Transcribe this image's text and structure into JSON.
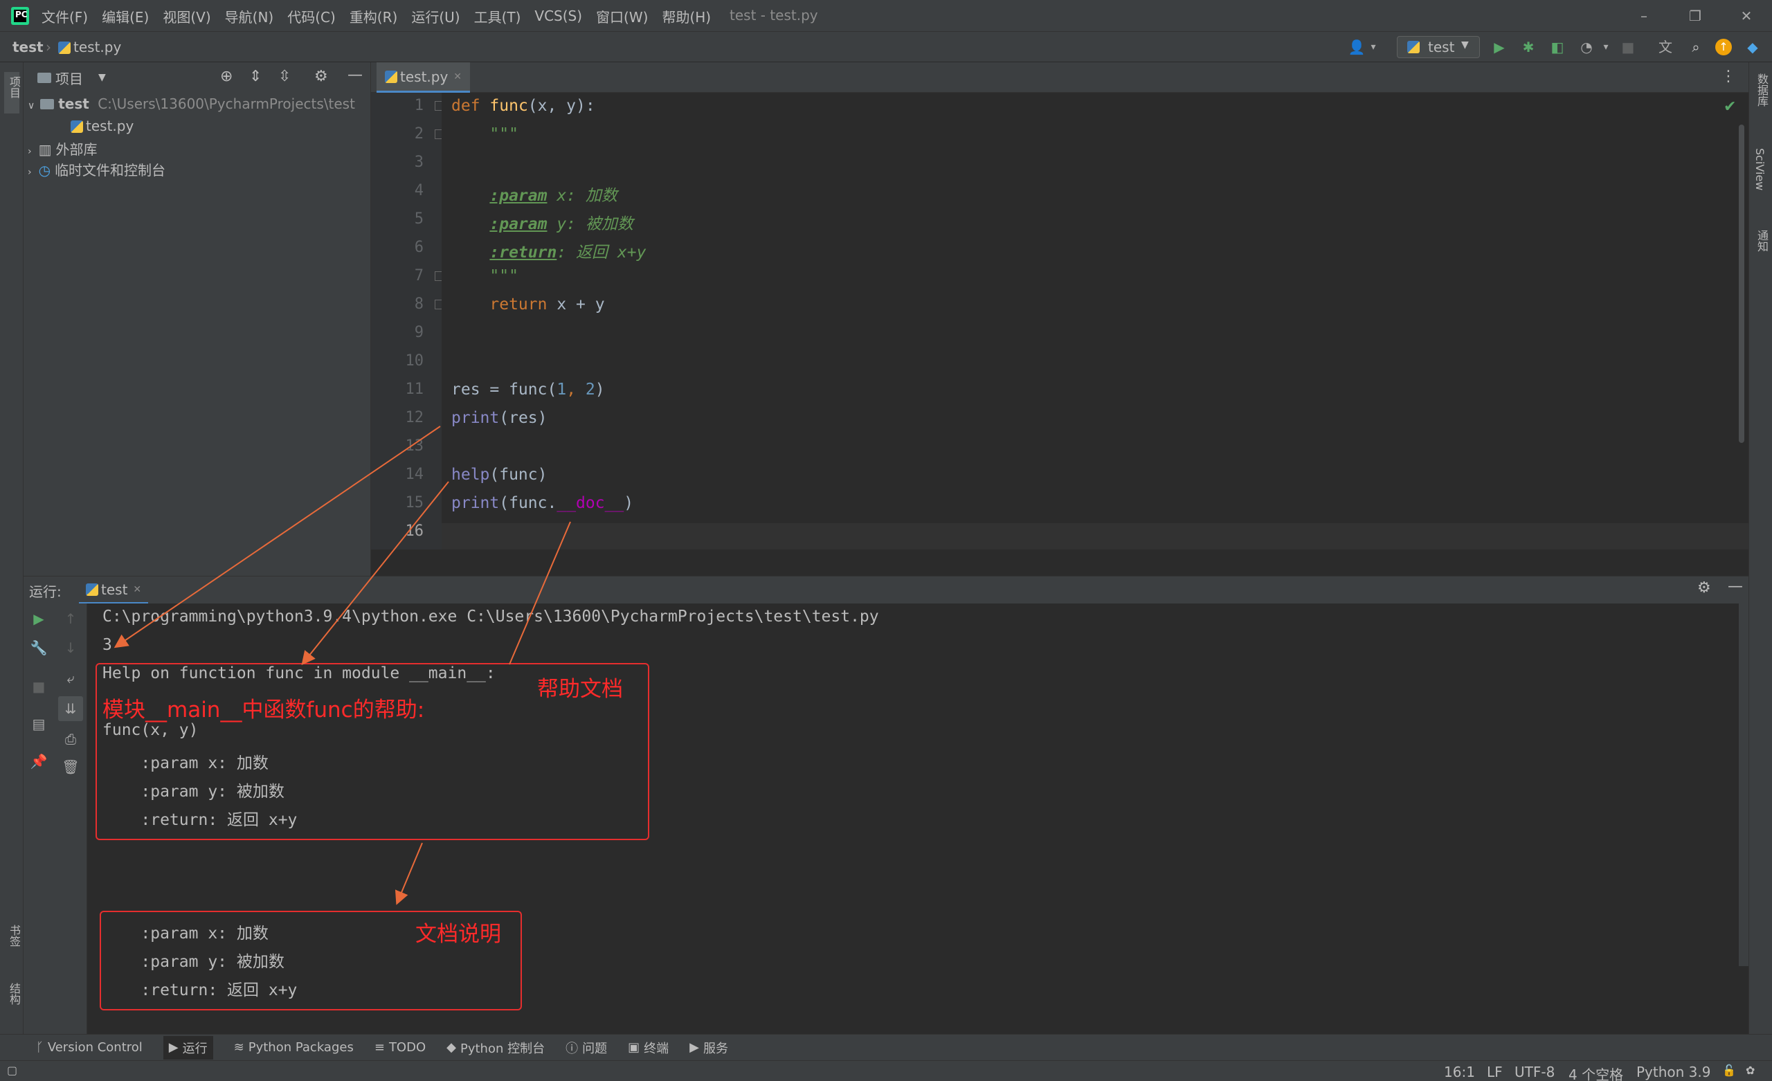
{
  "window": {
    "title": "test - test.py",
    "minimize": "–",
    "maximize": "❐",
    "close": "✕"
  },
  "menu": [
    "文件(F)",
    "编辑(E)",
    "视图(V)",
    "导航(N)",
    "代码(C)",
    "重构(R)",
    "运行(U)",
    "工具(T)",
    "VCS(S)",
    "窗口(W)",
    "帮助(H)"
  ],
  "navbar": {
    "project": "test",
    "file": "test.py",
    "run_config": "test"
  },
  "left_stripe": {
    "project_label": "项目",
    "bookmarks_label": "书签",
    "structure_label": "结构"
  },
  "right_stripe": {
    "database_label": "数据库",
    "sciview_label": "SciView",
    "notifications_label": "通知"
  },
  "project_panel": {
    "header": "项目",
    "root_name": "test",
    "root_path": "C:\\Users\\13600\\PycharmProjects\\test",
    "file": "test.py",
    "external_libs": "外部库",
    "scratches": "临时文件和控制台"
  },
  "editor": {
    "tab": "test.py",
    "line_numbers": [
      "1",
      "2",
      "3",
      "4",
      "5",
      "6",
      "7",
      "8",
      "9",
      "10",
      "11",
      "12",
      "13",
      "14",
      "15",
      "16"
    ]
  },
  "code": {
    "l1_def": "def",
    "l1_name": "func",
    "l1_rest": "(x, y):",
    "l2": "\"\"\"",
    "l4_tag": ":param",
    "l4_rest": " x: 加数",
    "l5_tag": ":param",
    "l5_rest": " y: 被加数",
    "l6_tag": ":return",
    "l6_rest": ": 返回 x+y",
    "l7": "\"\"\"",
    "l8_kw": "return",
    "l8_rest": " x + y",
    "l11_a": "res = func(",
    "l11_n1": "1",
    "l11_c": ", ",
    "l11_n2": "2",
    "l11_e": ")",
    "l12_bi": "print",
    "l12_rest": "(res)",
    "l14_bi": "help",
    "l14_rest": "(func)",
    "l15_bi": "print",
    "l15_a": "(func.",
    "l15_magic": "__doc__",
    "l15_e": ")"
  },
  "run_panel": {
    "label": "运行:",
    "tab": "test"
  },
  "console": {
    "cmd": "C:\\programming\\python3.9.4\\python.exe C:\\Users\\13600\\PycharmProjects\\test\\test.py",
    "out1": "3",
    "help_header": "Help on function func in module __main__:",
    "help_sig": "func(x, y)",
    "p1": "    :param x: 加数",
    "p2": "    :param y: 被加数",
    "p3": "    :return: 返回 x+y",
    "d1": "    :param x: 加数",
    "d2": "    :param y: 被加数",
    "d3": "    :return: 返回 x+y"
  },
  "annotations": {
    "help_doc": "帮助文档",
    "module_help": "模块__main__中函数func的帮助:",
    "doc_desc": "文档说明",
    "accent": "#e52e2e"
  },
  "bottom_tools": [
    {
      "icon": "ᚴ",
      "label": "Version Control"
    },
    {
      "icon": "▶",
      "label": "运行"
    },
    {
      "icon": "≋",
      "label": "Python Packages"
    },
    {
      "icon": "≡",
      "label": "TODO"
    },
    {
      "icon": "◆",
      "label": "Python 控制台"
    },
    {
      "icon": "ⓘ",
      "label": "问题"
    },
    {
      "icon": "▣",
      "label": "终端"
    },
    {
      "icon": "▶",
      "label": "服务"
    }
  ],
  "status": {
    "position": "16:1",
    "line_sep": "LF",
    "encoding": "UTF-8",
    "indent": "4 个空格",
    "interpreter": "Python 3.9"
  }
}
